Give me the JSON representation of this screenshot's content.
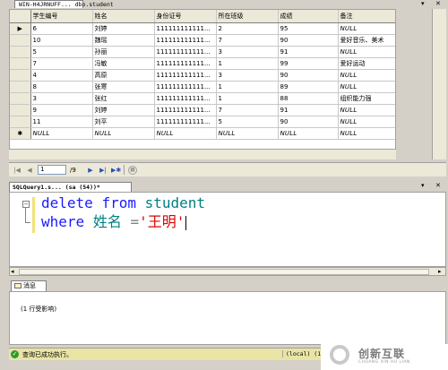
{
  "document_tabs": [
    {
      "label": "WIN-H4JRNUFF... dbo.student",
      "active": true
    }
  ],
  "grid": {
    "columns": [
      "学生编号",
      "姓名",
      "身份证号",
      "所在班级",
      "成绩",
      "备注"
    ],
    "rows": [
      {
        "indicator": "▶",
        "cells": [
          "6",
          "刘婷",
          "111111111111...",
          "2",
          "95",
          "NULL"
        ]
      },
      {
        "indicator": "",
        "cells": [
          "10",
          "魏瑶",
          "111111111111...",
          "7",
          "90",
          "爱好音乐、美术"
        ]
      },
      {
        "indicator": "",
        "cells": [
          "5",
          "孙丽",
          "111111111111...",
          "3",
          "91",
          "NULL"
        ]
      },
      {
        "indicator": "",
        "cells": [
          "7",
          "冯敏",
          "111111111111...",
          "1",
          "99",
          "爱好运动"
        ]
      },
      {
        "indicator": "",
        "cells": [
          "4",
          "高原",
          "111111111111...",
          "3",
          "90",
          "NULL"
        ]
      },
      {
        "indicator": "",
        "cells": [
          "8",
          "张寒",
          "111111111111...",
          "1",
          "89",
          "NULL"
        ]
      },
      {
        "indicator": "",
        "cells": [
          "3",
          "张红",
          "111111111111...",
          "1",
          "88",
          "组织能力强"
        ]
      },
      {
        "indicator": "",
        "cells": [
          "9",
          "刘婷",
          "111111111111...",
          "7",
          "91",
          "NULL"
        ]
      },
      {
        "indicator": "",
        "cells": [
          "11",
          "刘平",
          "111111111111...",
          "5",
          "90",
          "NULL"
        ]
      },
      {
        "indicator": "✱",
        "cells": [
          "NULL",
          "NULL",
          "NULL",
          "NULL",
          "NULL",
          "NULL"
        ]
      }
    ]
  },
  "navigator": {
    "current_record": "1",
    "total_label": "/9"
  },
  "query_tab": {
    "label": "SQLQuery1.s... (sa (54))*"
  },
  "editor": {
    "line1": {
      "keyword": "delete",
      "from": "from",
      "table": "student"
    },
    "line2": {
      "keyword": "where",
      "column": "姓名",
      "operator": "=",
      "value": "'王明'"
    }
  },
  "messages": {
    "tab_label": "消息",
    "text": "(1 行受影响)"
  },
  "status_bar": {
    "text": "查询已成功执行。",
    "server": "(local) (10.0 RTM"
  },
  "watermark": {
    "cn": "创新互联",
    "en": "CHUANG XIN HU LIAN"
  },
  "colors": {
    "keyword": "#1a1aff",
    "identifier": "#008080",
    "string": "#e00000",
    "status_bar_bg": "#e9e4a4"
  }
}
